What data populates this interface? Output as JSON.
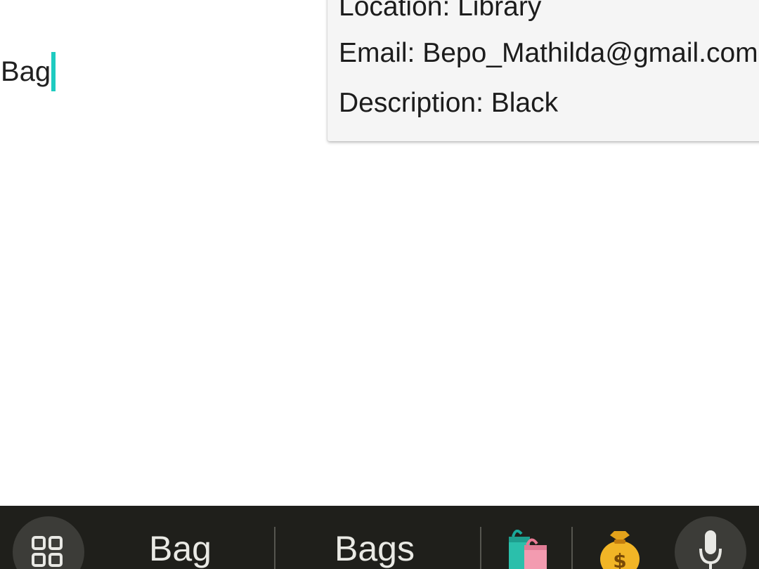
{
  "search": {
    "query": "Bag"
  },
  "popup": {
    "location_line": "Location: Library",
    "email_line": "Email: Bepo_Mathilda@gmail.com",
    "description_line": "Description: Black"
  },
  "keyboard": {
    "suggestions": [
      "Bag",
      "Bags"
    ],
    "emoji_suggestions": [
      "shopping-bags-emoji",
      "money-bag-emoji"
    ],
    "colors": {
      "bar_background": "#1f1f1b",
      "button_background": "#3c3c38",
      "caret": "#1ecbc0"
    }
  }
}
